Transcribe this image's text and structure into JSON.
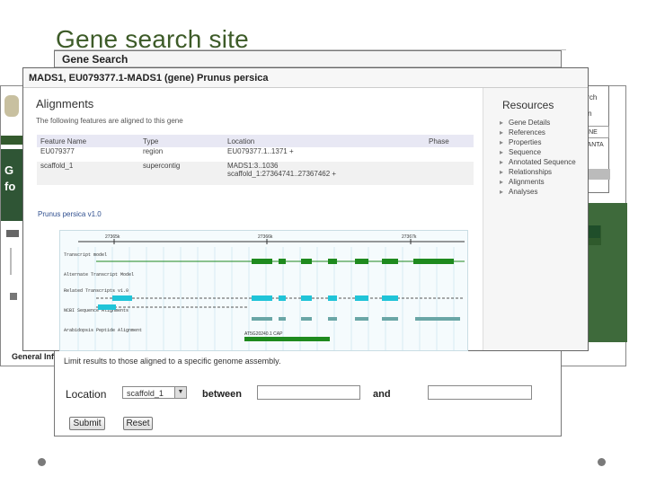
{
  "slide": {
    "title": "Gene search site"
  },
  "gene_search": {
    "header": "Gene Search",
    "limit_text": "Limit results to those aligned to a specific genome assembly.",
    "location_label": "Location",
    "location_value": "scaffold_1",
    "between_label": "between",
    "and_label": "and",
    "submit_label": "Submit",
    "reset_label": "Reset"
  },
  "site": {
    "banner_lines": [
      "G",
      "fo"
    ],
    "footer_text": "General Info",
    "search_link": "Search",
    "login_link": "Login",
    "tab_text": "GENE PLANTA"
  },
  "feature": {
    "header": "MADS1, EU079377.1-MADS1 (gene) Prunus persica",
    "alignments_title": "Alignments",
    "alignments_desc": "The following features are aligned to this gene",
    "columns": [
      "Feature Name",
      "Type",
      "Location",
      "Phase"
    ],
    "rows": [
      {
        "name": "EU079377",
        "type": "region",
        "location": "EU079377.1..1371 +",
        "location2": "",
        "phase": ""
      },
      {
        "name": "scaffold_1",
        "type": "supercontig",
        "location": "MADS1:3..1036",
        "location2": "scaffold_1:27364741..27367462 +",
        "phase": ""
      }
    ],
    "assembly_title": "Prunus persica v1.0",
    "resources_title": "Resources",
    "resources": [
      "Gene Details",
      "References",
      "Properties",
      "Sequence",
      "Annotated Sequence",
      "Relationships",
      "Alignments",
      "Analyses"
    ]
  },
  "browser": {
    "scale_ticks": [
      "27365k",
      "27366k",
      "27367k"
    ],
    "tracks": [
      "Transcript model",
      "Alternate Transcript Model",
      "Related Transcripts v1.0",
      "NCBI Sequence Alignments",
      "Arabidopsis Peptide Alignment"
    ],
    "labels": [
      "AT5G20240.1 CAP"
    ],
    "colors": {
      "gene": "#1e8a1e",
      "transcript": "#20c4d8",
      "ncbi": "#6aa6a6"
    }
  }
}
